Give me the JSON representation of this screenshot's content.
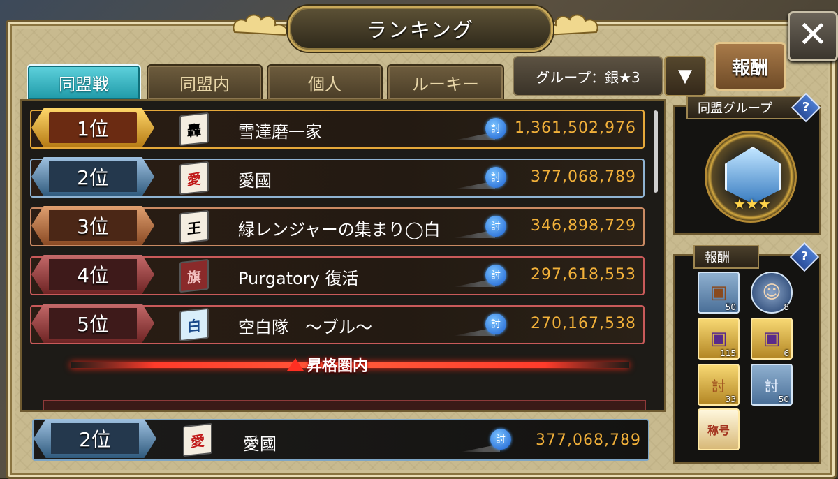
{
  "title": "ランキング",
  "close_label": "✕",
  "tabs": [
    {
      "label": "同盟戦",
      "active": true
    },
    {
      "label": "同盟内",
      "active": false
    },
    {
      "label": "個人",
      "active": false
    },
    {
      "label": "ルーキー",
      "active": false
    }
  ],
  "group_selector": {
    "value": "グループ：銀★3",
    "arrow": "▼"
  },
  "reward_button": "報酬",
  "rankings": [
    {
      "rank": "1位",
      "flag": "轟",
      "name": "雪達磨一家",
      "score": "1,361,502,976"
    },
    {
      "rank": "2位",
      "flag": "愛",
      "name": "愛國",
      "score": "377,068,789"
    },
    {
      "rank": "3位",
      "flag": "王",
      "name": "緑レンジャーの集まり◯白",
      "score": "346,898,729"
    },
    {
      "rank": "4位",
      "flag": "旗",
      "name": "Purgatory 復活",
      "score": "297,618,553"
    },
    {
      "rank": "5位",
      "flag": "白",
      "name": "空白隊　〜ブル〜",
      "score": "270,167,538"
    }
  ],
  "score_icon_label": "討",
  "promotion_label": "昇格圏内",
  "own_entry": {
    "rank": "2位",
    "flag": "愛",
    "name": "愛國",
    "score": "377,068,789"
  },
  "alliance_group_panel": {
    "title": "同盟グループ",
    "help": "?",
    "stars": "★★★"
  },
  "rewards_panel": {
    "title": "報酬",
    "help": "?",
    "items": [
      {
        "icon": "chest-icon",
        "glyph": "▣",
        "qty": "50",
        "style": "blue"
      },
      {
        "icon": "character-portrait-icon",
        "glyph": "☺",
        "qty": "8",
        "style": "round"
      },
      {
        "icon": "purple-chest-icon",
        "glyph": "▣",
        "qty": "115",
        "style": "gold"
      },
      {
        "icon": "mystery-chest-icon",
        "glyph": "▣",
        "qty": "6",
        "style": "gold"
      },
      {
        "icon": "gold-ticket-icon",
        "glyph": "討",
        "qty": "33",
        "style": "gold"
      },
      {
        "icon": "silver-ticket-icon",
        "glyph": "討",
        "qty": "50",
        "style": "blue"
      },
      {
        "icon": "title-badge-icon",
        "glyph": "称号",
        "qty": "",
        "style": "cream"
      }
    ]
  }
}
